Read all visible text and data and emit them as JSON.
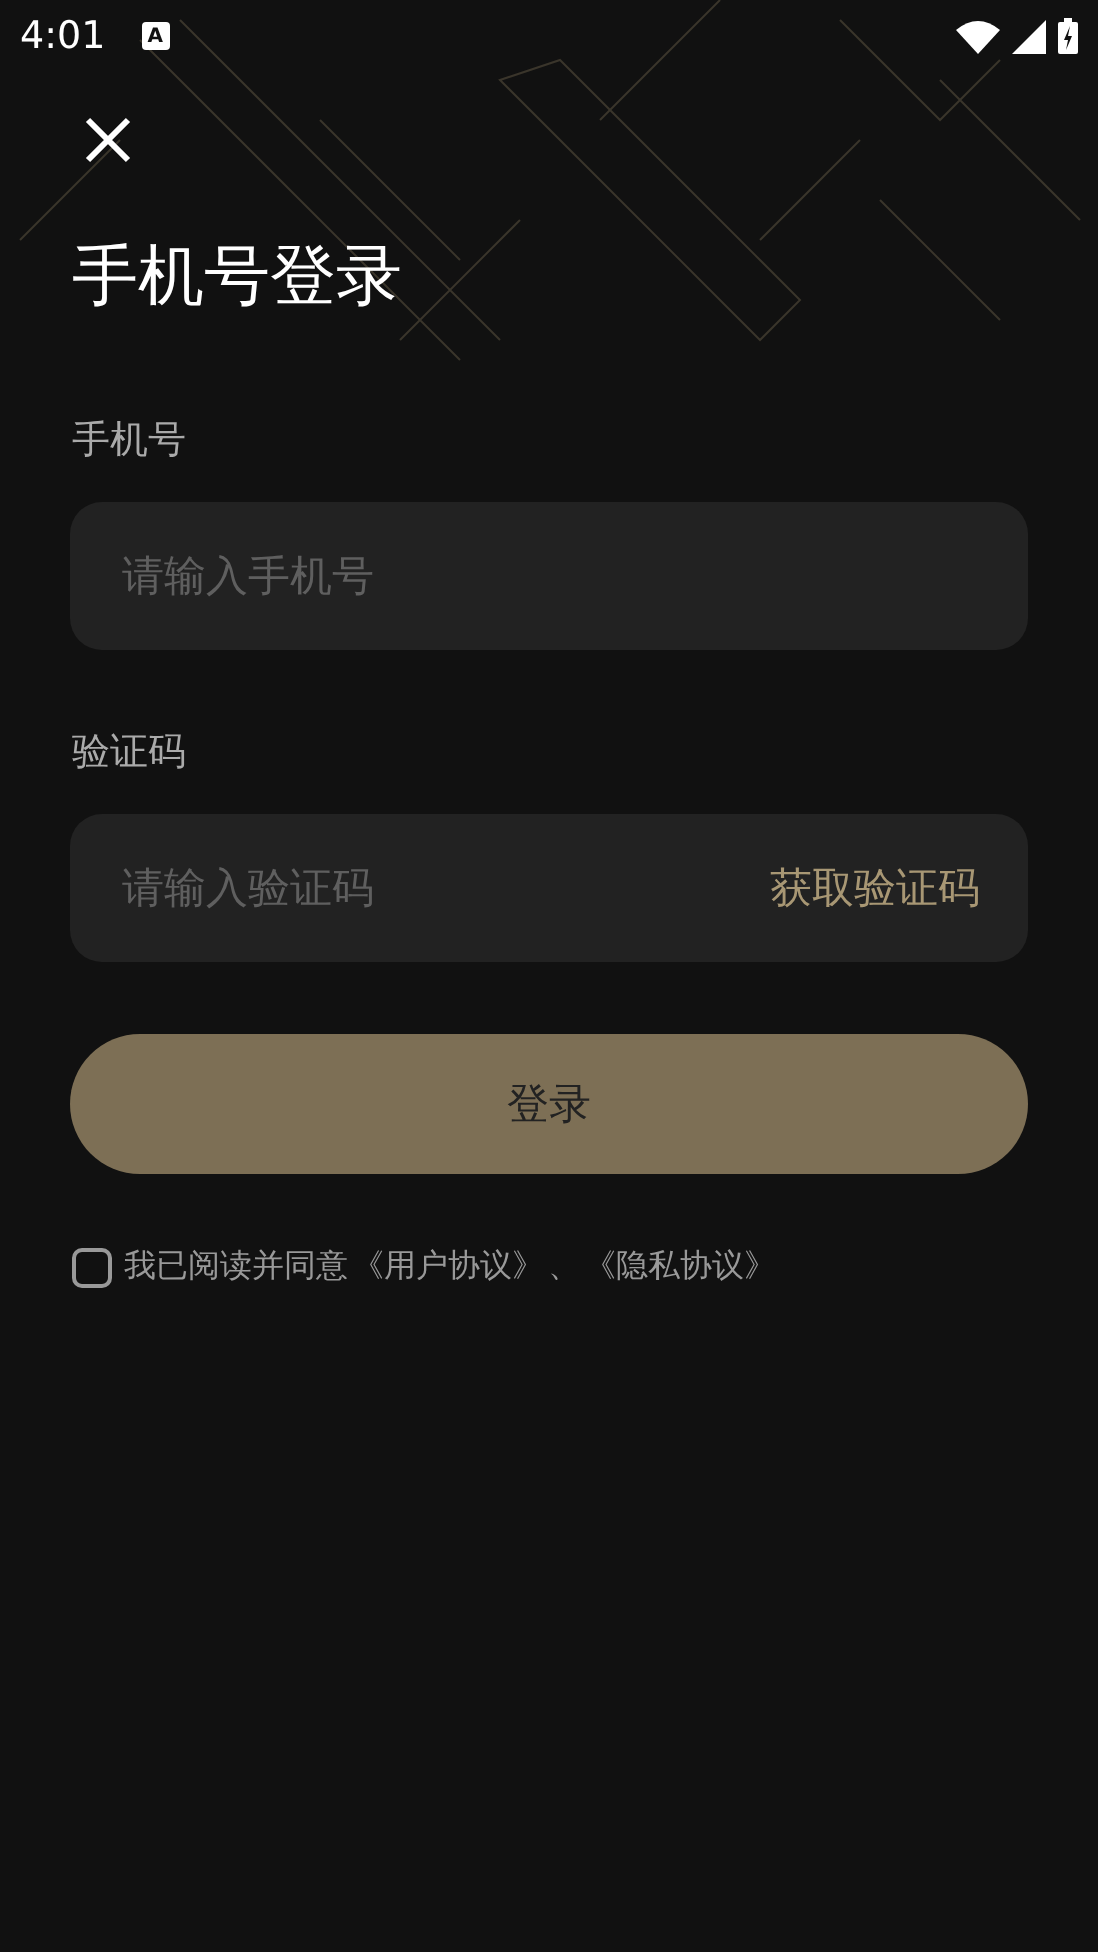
{
  "status_bar": {
    "time": "4:01",
    "notification": "A"
  },
  "title": "手机号登录",
  "phone": {
    "label": "手机号",
    "placeholder": "请输入手机号"
  },
  "code": {
    "label": "验证码",
    "placeholder": "请输入验证码",
    "action": "获取验证码"
  },
  "login_button": "登录",
  "agreement": {
    "checked": false,
    "text": "我已阅读并同意",
    "links": [
      "《用户协议》",
      "《隐私协议》"
    ],
    "separator": "、"
  }
}
